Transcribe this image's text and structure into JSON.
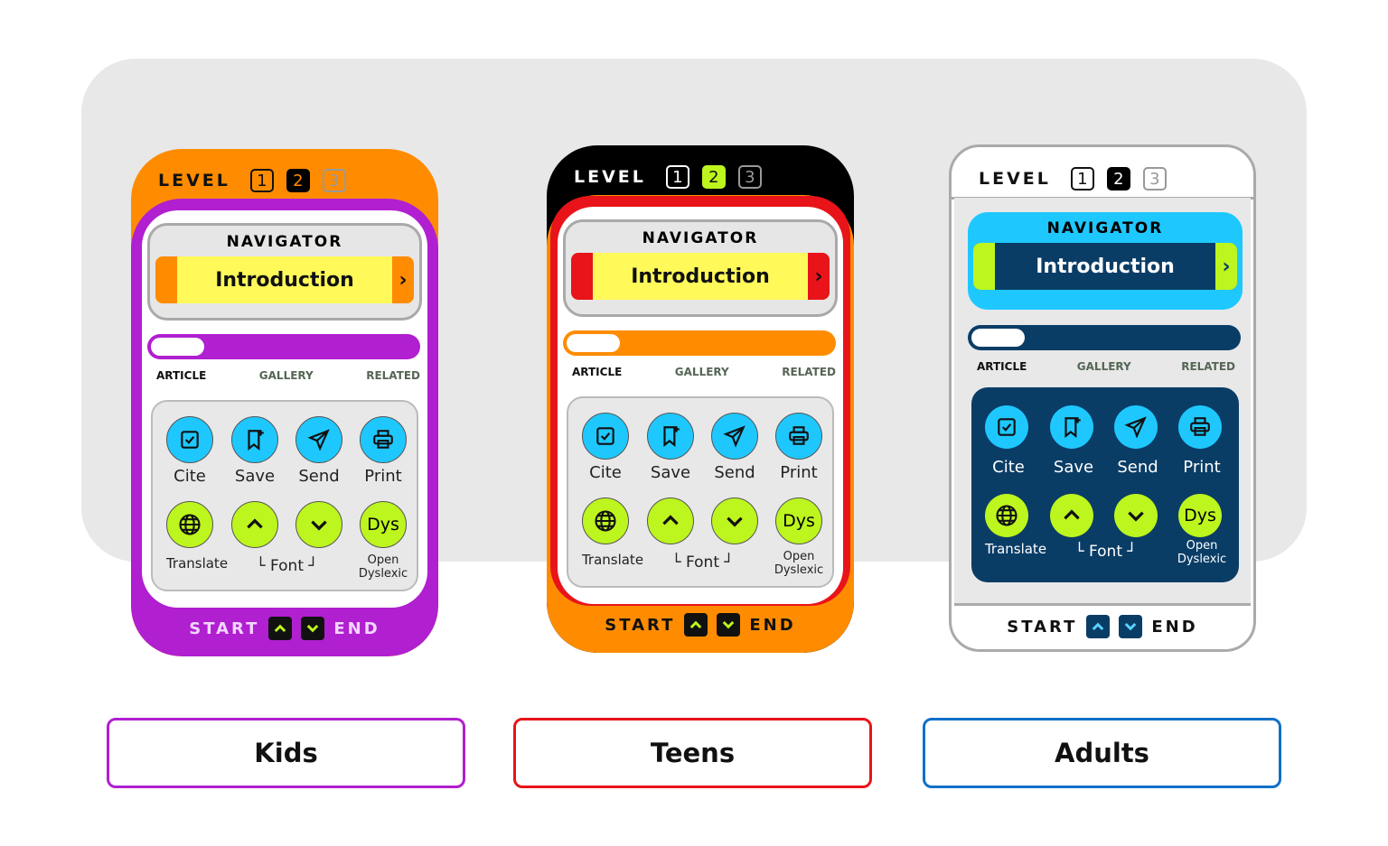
{
  "cards": [
    {
      "level_label": "LEVEL",
      "levels": [
        "1",
        "2",
        "3"
      ],
      "active_level": "2",
      "navigator": "NAVIGATOR",
      "section": "Introduction",
      "tabs": [
        "ARTICLE",
        "GALLERY",
        "RELATED"
      ],
      "tools": [
        "Cite",
        "Save",
        "Send",
        "Print"
      ],
      "tools2": [
        "Translate",
        "Font",
        "Open",
        "Dyslexic"
      ],
      "dys": "Dys",
      "start": "START",
      "end": "END",
      "label": "Kids",
      "progress": 0.2,
      "colors": {
        "header": "#ff8c00",
        "frame": "#b01fd0",
        "inner": "#ffffff",
        "nav": "#e6e6e6",
        "bar": "#fff95a",
        "bar_edge": "#ff8c00",
        "prog": "#b01fd0",
        "tools_bg": "#e8e8e8",
        "tool_text": "#222",
        "blue_icon": "#1ec8ff",
        "green_icon": "#bdf51e",
        "foot_text": "#f2d6ff",
        "foot_btn": "#111",
        "accent": "#b01fd0",
        "hdr_text": "#111",
        "intro_text": "#111"
      }
    },
    {
      "level_label": "LEVEL",
      "levels": [
        "1",
        "2",
        "3"
      ],
      "active_level": "2",
      "navigator": "NAVIGATOR",
      "section": "Introduction",
      "tabs": [
        "ARTICLE",
        "GALLERY",
        "RELATED"
      ],
      "tools": [
        "Cite",
        "Save",
        "Send",
        "Print"
      ],
      "tools2": [
        "Translate",
        "Font",
        "Open",
        "Dyslexic"
      ],
      "dys": "Dys",
      "start": "START",
      "end": "END",
      "label": "Teens",
      "progress": 0.2,
      "colors": {
        "header": "#000000",
        "frame": "#e8141a",
        "inner": "#ffffff",
        "nav": "#e6e6e6",
        "bar": "#fff95a",
        "bar_edge": "#e8141a",
        "prog": "#ff8c00",
        "tools_bg": "#e8e8e8",
        "tool_text": "#222",
        "blue_icon": "#1ec8ff",
        "green_icon": "#bdf51e",
        "foot_text": "#111",
        "foot_btn": "#111",
        "accent": "#e8141a",
        "hdr_text": "#ffffff",
        "intro_text": "#111",
        "footer_bg": "#ff8c00"
      }
    },
    {
      "level_label": "LEVEL",
      "levels": [
        "1",
        "2",
        "3"
      ],
      "active_level": "2",
      "navigator": "NAVIGATOR",
      "section": "Introduction",
      "tabs": [
        "ARTICLE",
        "GALLERY",
        "RELATED"
      ],
      "tools": [
        "Cite",
        "Save",
        "Send",
        "Print"
      ],
      "tools2": [
        "Translate",
        "Font",
        "Open",
        "Dyslexic"
      ],
      "dys": "Dys",
      "start": "START",
      "end": "END",
      "label": "Adults",
      "progress": 0.2,
      "colors": {
        "header": "#ffffff",
        "frame": "#ffffff",
        "inner": "#e8e8e8",
        "nav": "#1ec8ff",
        "bar": "#0a3d66",
        "bar_edge": "#bdf51e",
        "prog": "#0a3d66",
        "tools_bg": "#0a3d66",
        "tool_text": "#ffffff",
        "blue_icon": "#1ec8ff",
        "green_icon": "#bdf51e",
        "foot_text": "#111",
        "foot_btn": "#0a3d66",
        "accent": "#1070c8",
        "hdr_text": "#111",
        "intro_text": "#ffffff"
      }
    }
  ]
}
